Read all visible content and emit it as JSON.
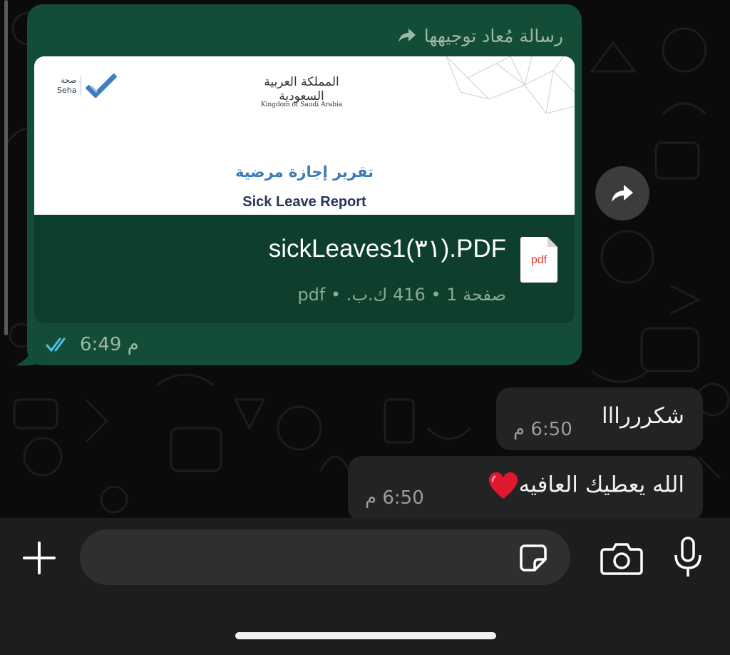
{
  "forwarded_message": {
    "forwarded_label": "رسالة مُعاد توجيهها",
    "preview": {
      "brand_ar": "صحة",
      "brand_en": "Seha",
      "emblem_ar": "المملكة العربية السعودية",
      "emblem_en": "Kingdom of Saudi Arabia",
      "title_ar": "تقرير إجازة مرضية",
      "title_en": "Sick Leave Report"
    },
    "file_type_badge": "pdf",
    "file_name": "sickLeaves1(٣١).PDF",
    "file_meta": "صفحة 1 • 416 ك.ب. • pdf",
    "time": "6:49 م",
    "read_status": "read"
  },
  "incoming_messages": [
    {
      "text": "شكرررااا",
      "time": "6:50 م"
    },
    {
      "text": "الله يعطيك العافيه",
      "time": "6:50 م",
      "emoji": "heart"
    }
  ],
  "input_bar": {
    "placeholder": "",
    "icons": [
      "plus-icon",
      "sticker-icon",
      "camera-icon",
      "microphone-icon"
    ]
  },
  "colors": {
    "outgoing_bubble": "#144d37",
    "incoming_bubble": "#222323",
    "read_ticks": "#53bdeb",
    "background": "#0b0b0b"
  }
}
